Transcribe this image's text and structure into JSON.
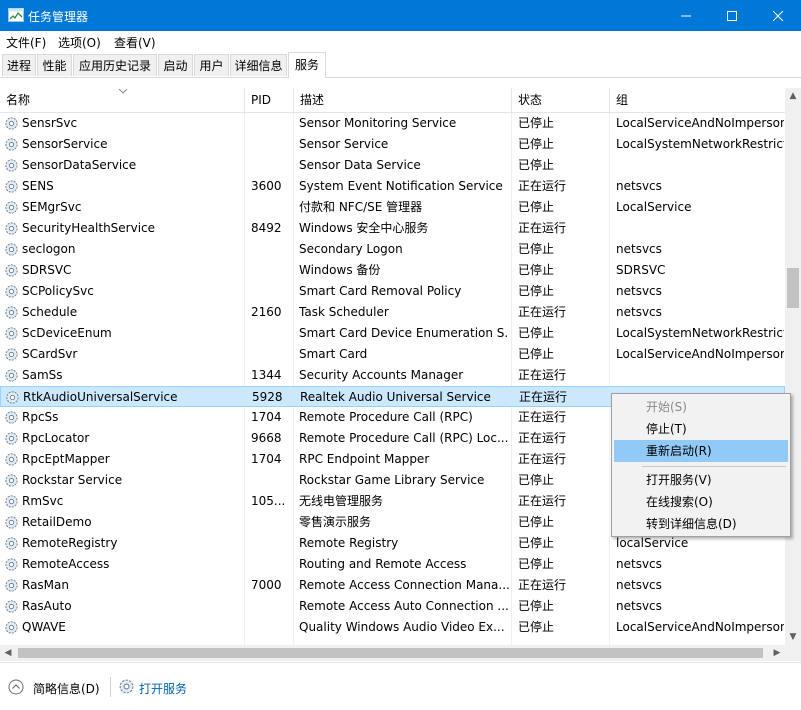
{
  "window": {
    "title": "任务管理器"
  },
  "menubar": [
    "文件(F)",
    "选项(O)",
    "查看(V)"
  ],
  "tabs": [
    {
      "label": "进程"
    },
    {
      "label": "性能"
    },
    {
      "label": "应用历史记录"
    },
    {
      "label": "启动"
    },
    {
      "label": "用户"
    },
    {
      "label": "详细信息"
    },
    {
      "label": "服务",
      "active": true
    }
  ],
  "columns": [
    "名称",
    "PID",
    "描述",
    "状态",
    "组"
  ],
  "rows": [
    [
      "SensrSvc",
      "",
      "Sensor Monitoring Service",
      "已停止",
      "LocalServiceAndNoImperson"
    ],
    [
      "SensorService",
      "",
      "Sensor Service",
      "已停止",
      "LocalSystemNetworkRestricte"
    ],
    [
      "SensorDataService",
      "",
      "Sensor Data Service",
      "已停止",
      ""
    ],
    [
      "SENS",
      "3600",
      "System Event Notification Service",
      "正在运行",
      "netsvcs"
    ],
    [
      "SEMgrSvc",
      "",
      "付款和 NFC/SE 管理器",
      "已停止",
      "LocalService"
    ],
    [
      "SecurityHealthService",
      "8492",
      "Windows 安全中心服务",
      "正在运行",
      ""
    ],
    [
      "seclogon",
      "",
      "Secondary Logon",
      "已停止",
      "netsvcs"
    ],
    [
      "SDRSVC",
      "",
      "Windows 备份",
      "已停止",
      "SDRSVC"
    ],
    [
      "SCPolicySvc",
      "",
      "Smart Card Removal Policy",
      "已停止",
      "netsvcs"
    ],
    [
      "Schedule",
      "2160",
      "Task Scheduler",
      "正在运行",
      "netsvcs"
    ],
    [
      "ScDeviceEnum",
      "",
      "Smart Card Device Enumeration S...",
      "已停止",
      "LocalSystemNetworkRestricte"
    ],
    [
      "SCardSvr",
      "",
      "Smart Card",
      "已停止",
      "LocalServiceAndNoImperson"
    ],
    [
      "SamSs",
      "1344",
      "Security Accounts Manager",
      "正在运行",
      ""
    ],
    [
      "RtkAudioUniversalService",
      "5928",
      "Realtek Audio Universal Service",
      "正在运行",
      ""
    ],
    [
      "RpcSs",
      "1704",
      "Remote Procedure Call (RPC)",
      "正在运行",
      ""
    ],
    [
      "RpcLocator",
      "9668",
      "Remote Procedure Call (RPC) Loc...",
      "正在运行",
      ""
    ],
    [
      "RpcEptMapper",
      "1704",
      "RPC Endpoint Mapper",
      "正在运行",
      ""
    ],
    [
      "Rockstar Service",
      "",
      "Rockstar Game Library Service",
      "已停止",
      ""
    ],
    [
      "RmSvc",
      "105...",
      "无线电管理服务",
      "正在运行",
      ""
    ],
    [
      "RetailDemo",
      "",
      "零售演示服务",
      "已停止",
      ""
    ],
    [
      "RemoteRegistry",
      "",
      "Remote Registry",
      "已停止",
      "localService"
    ],
    [
      "RemoteAccess",
      "",
      "Routing and Remote Access",
      "已停止",
      "netsvcs"
    ],
    [
      "RasMan",
      "7000",
      "Remote Access Connection Mana...",
      "正在运行",
      "netsvcs"
    ],
    [
      "RasAuto",
      "",
      "Remote Access Auto Connection ...",
      "已停止",
      "netsvcs"
    ],
    [
      "QWAVE",
      "",
      "Quality Windows Audio Video Ex...",
      "已停止",
      "LocalServiceAndNoImperson"
    ]
  ],
  "selected_row": "RtkAudioUniversalService",
  "context_menu": {
    "group1": [
      {
        "label": "开始(S)",
        "disabled": true
      },
      {
        "label": "停止(T)"
      },
      {
        "label": "重新启动(R)",
        "highlighted": true
      }
    ],
    "group2": [
      {
        "label": "打开服务(V)"
      },
      {
        "label": "在线搜索(O)"
      },
      {
        "label": "转到详细信息(D)"
      }
    ]
  },
  "footer": {
    "summary": "简略信息(D)",
    "open_services": "打开服务"
  },
  "colors": {
    "titlebar": "#0078d7",
    "selected_row": "#cce8ff",
    "menu_highlight": "#91c9f7",
    "link": "#0063b1"
  }
}
